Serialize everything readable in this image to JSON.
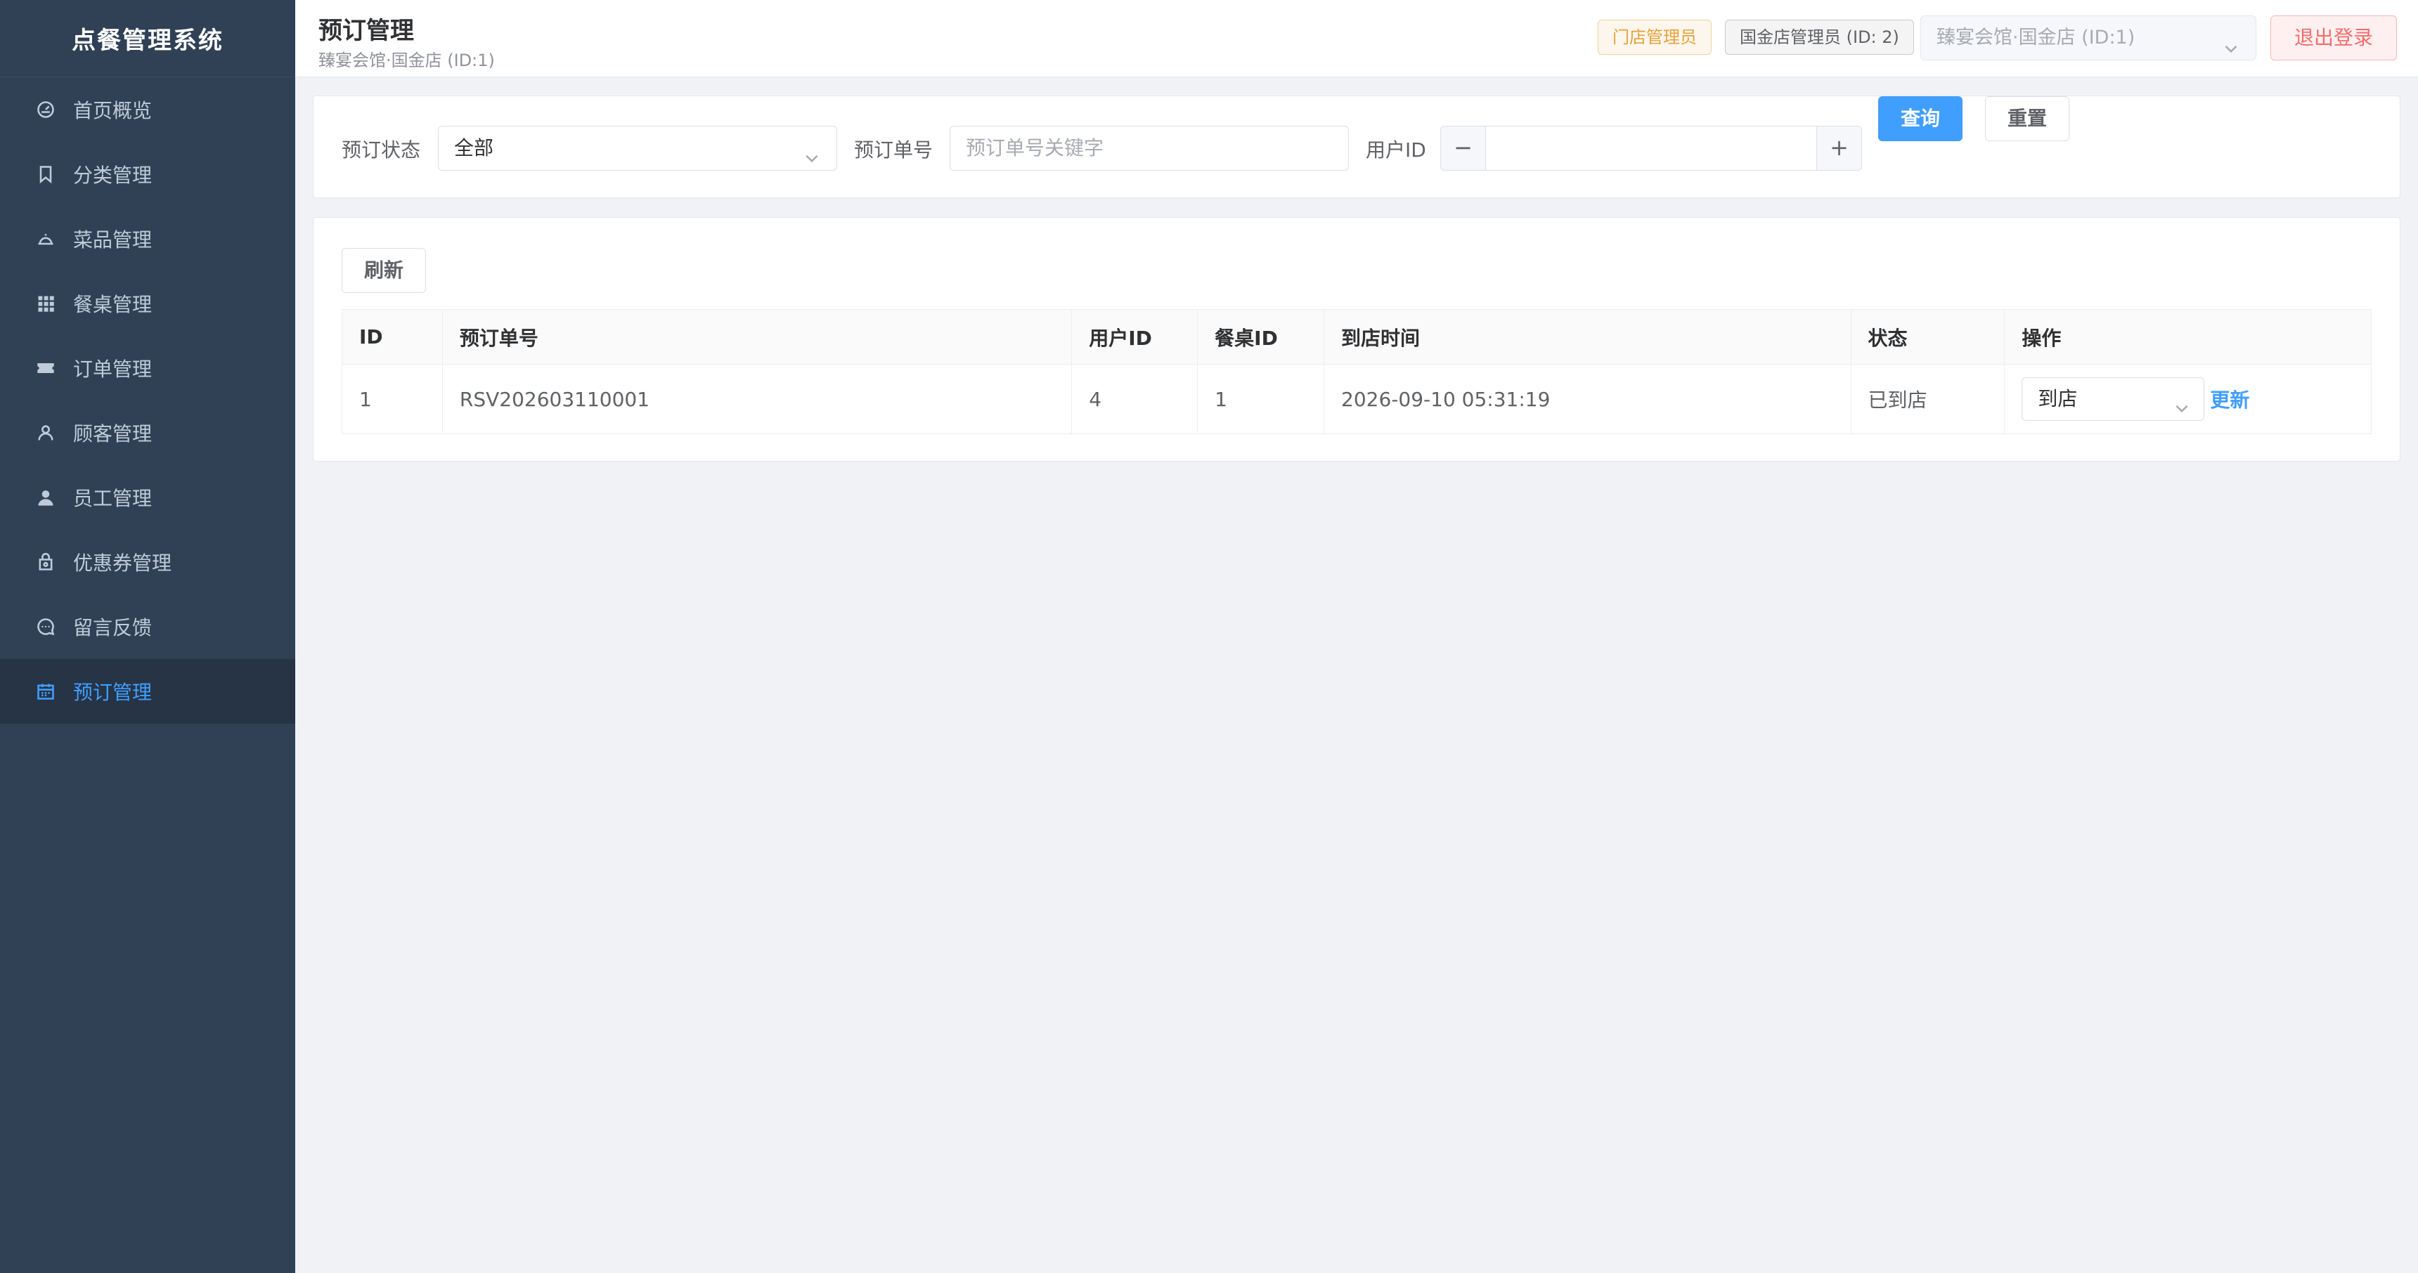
{
  "app": {
    "title": "点餐管理系统"
  },
  "sidebar": {
    "items": [
      {
        "label": "首页概览",
        "icon": "dashboard-icon"
      },
      {
        "label": "分类管理",
        "icon": "bookmark-icon"
      },
      {
        "label": "菜品管理",
        "icon": "dish-icon"
      },
      {
        "label": "餐桌管理",
        "icon": "grid-icon"
      },
      {
        "label": "订单管理",
        "icon": "ticket-icon"
      },
      {
        "label": "顾客管理",
        "icon": "user-outline-icon"
      },
      {
        "label": "员工管理",
        "icon": "user-solid-icon"
      },
      {
        "label": "优惠券管理",
        "icon": "coupon-icon"
      },
      {
        "label": "留言反馈",
        "icon": "chat-icon"
      },
      {
        "label": "预订管理",
        "icon": "calendar-icon",
        "active": true
      }
    ]
  },
  "header": {
    "title": "预订管理",
    "subtitle": "臻宴会馆·国金店 (ID:1)",
    "role_tag": "门店管理员",
    "user_tag": "国金店管理员 (ID: 2)",
    "store_select": "臻宴会馆·国金店 (ID:1)",
    "logout_label": "退出登录"
  },
  "filters": {
    "status_label": "预订状态",
    "status_value": "全部",
    "order_no_label": "预订单号",
    "order_no_placeholder": "预订单号关键字",
    "user_id_label": "用户ID",
    "minus": "−",
    "plus": "+",
    "query_label": "查询",
    "reset_label": "重置"
  },
  "list": {
    "refresh_label": "刷新",
    "columns": [
      "ID",
      "预订单号",
      "用户ID",
      "餐桌ID",
      "到店时间",
      "状态",
      "操作"
    ],
    "rows": [
      {
        "id": "1",
        "order_no": "RSV202603110001",
        "user_id": "4",
        "table_id": "1",
        "arrival_time": "2026-09-10 05:31:19",
        "status": "已到店",
        "action_select": "到店",
        "action_link": "更新"
      }
    ]
  },
  "colors": {
    "sidebar_bg": "#304156",
    "accent": "#409eff",
    "danger": "#f56c6c",
    "warning": "#e6a23c"
  }
}
